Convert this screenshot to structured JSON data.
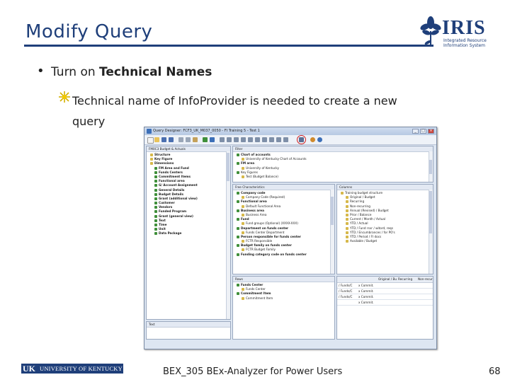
{
  "slide": {
    "title": "Modify Query",
    "bullet_prefix": "Turn on ",
    "bullet_bold": "Technical Names",
    "sub_bullet_line1": "Technical name of InfoProvider is needed to create a new",
    "sub_bullet_line2": "query",
    "footer_text": "BEX_305 BEx-Analyzer for Power Users",
    "page_number": "68"
  },
  "logo": {
    "brand": "IRIS",
    "tagline": "Integrated Resource Information System"
  },
  "footer_logo": {
    "uk": "UK",
    "university": "UNIVERSITY OF KENTUCKY"
  },
  "screenshot": {
    "window_title": "Query Designer: FCF3_UK_M037_0050 - FI Training 5 - Test 1",
    "left_pane": {
      "header": "FM0C3 Budget & Actuals",
      "items": [
        {
          "label": "Structure",
          "bold": true,
          "color": "#d6b84a"
        },
        {
          "label": "Key Figure",
          "bold": true,
          "color": "#d6b84a"
        },
        {
          "label": "Dimensions",
          "bold": true,
          "color": "#d6b84a"
        },
        {
          "label": "FM Area and Fund",
          "bold": true,
          "color": "#3f8f3a"
        },
        {
          "label": "Funds Centers",
          "bold": true,
          "color": "#3f8f3a"
        },
        {
          "label": "Commitment Items",
          "bold": true,
          "color": "#3f8f3a"
        },
        {
          "label": "Functional area",
          "bold": true,
          "color": "#3f8f3a"
        },
        {
          "label": "G/ Account Assignment",
          "bold": true,
          "color": "#3f8f3a"
        },
        {
          "label": "General Details",
          "bold": true,
          "color": "#3f8f3a"
        },
        {
          "label": "Budget Details",
          "bold": true,
          "color": "#3f8f3a"
        },
        {
          "label": "Grant (additional view)",
          "bold": true,
          "color": "#3f8f3a"
        },
        {
          "label": "Customer",
          "bold": true,
          "color": "#3f8f3a"
        },
        {
          "label": "Vendors",
          "bold": true,
          "color": "#3f8f3a"
        },
        {
          "label": "Funded Program",
          "bold": true,
          "color": "#3f8f3a"
        },
        {
          "label": "Grant (general view)",
          "bold": true,
          "color": "#3f8f3a"
        },
        {
          "label": "Text",
          "bold": true,
          "color": "#3f8f3a"
        },
        {
          "label": "Time",
          "bold": true,
          "color": "#3f8f3a"
        },
        {
          "label": "Unit",
          "bold": true,
          "color": "#3f8f3a"
        },
        {
          "label": "Data Package",
          "bold": true,
          "color": "#3f8f3a"
        }
      ]
    },
    "filter_pane": {
      "header": "Filter",
      "items": [
        {
          "label": "Chart of accounts",
          "bold": true,
          "color": "#3f8f3a"
        },
        {
          "label": "University of Kentucky Chart of Accounts",
          "bold": false,
          "color": "#d6b84a"
        },
        {
          "label": "FM area",
          "bold": true,
          "color": "#3f8f3a"
        },
        {
          "label": "University of Kentucky",
          "bold": false,
          "color": "#d6b84a"
        },
        {
          "label": "Key Figures",
          "bold": false,
          "color": "#3f8f3a"
        },
        {
          "label": "Test (Budget Balance)",
          "bold": false,
          "color": "#d6b84a"
        }
      ]
    },
    "free_char_pane": {
      "header": "Free Characteristics",
      "items": [
        {
          "label": "Company code",
          "bold": true,
          "color": "#3f8f3a"
        },
        {
          "label": "Company Code (Required)",
          "bold": false,
          "color": "#d6b84a"
        },
        {
          "label": "Functional area",
          "bold": true,
          "color": "#3f8f3a"
        },
        {
          "label": "Default Functional Area",
          "bold": false,
          "color": "#d6b84a"
        },
        {
          "label": "Business area",
          "bold": true,
          "color": "#3f8f3a"
        },
        {
          "label": "Business Area",
          "bold": false,
          "color": "#d6b84a"
        },
        {
          "label": "Fund",
          "bold": true,
          "color": "#3f8f3a"
        },
        {
          "label": "Fund groups (Optional) (XXXX-XXX)",
          "bold": false,
          "color": "#d6b84a"
        },
        {
          "label": "Department on funds center",
          "bold": true,
          "color": "#3f8f3a"
        },
        {
          "label": "Funds Center Department",
          "bold": false,
          "color": "#d6b84a"
        },
        {
          "label": "Person responsible for funds center",
          "bold": true,
          "color": "#3f8f3a"
        },
        {
          "label": "FCTR Responsible",
          "bold": false,
          "color": "#d6b84a"
        },
        {
          "label": "Budget family on funds center",
          "bold": true,
          "color": "#3f8f3a"
        },
        {
          "label": "FCTR Budget Family",
          "bold": false,
          "color": "#d6b84a"
        },
        {
          "label": "Funding category code on funds center",
          "bold": true,
          "color": "#3f8f3a"
        }
      ]
    },
    "columns_pane": {
      "header": "Columns",
      "items": [
        {
          "label": "Training budget structure",
          "bold": false,
          "color": "#d6b84a"
        },
        {
          "label": "Original / Budget",
          "bold": false,
          "color": "#d6b84a"
        },
        {
          "label": "Recurring",
          "bold": false,
          "color": "#d6b84a"
        },
        {
          "label": "Non-recurring",
          "bold": false,
          "color": "#d6b84a"
        },
        {
          "label": "Annual (Revised) / Budget",
          "bold": false,
          "color": "#d6b84a"
        },
        {
          "label": "Prior / Balance",
          "bold": false,
          "color": "#d6b84a"
        },
        {
          "label": "Current / Month / Actual",
          "bold": false,
          "color": "#d6b84a"
        },
        {
          "label": "YTD / Actual",
          "bold": false,
          "color": "#d6b84a"
        },
        {
          "label": "YTD / Fund rsvr / witord, reqs",
          "bold": false,
          "color": "#d6b84a"
        },
        {
          "label": "YTD / Encumbrances / for PO's",
          "bold": false,
          "color": "#d6b84a"
        },
        {
          "label": "YTD / Period / FI docs",
          "bold": false,
          "color": "#d6b84a"
        },
        {
          "label": "Available / Budget",
          "bold": false,
          "color": "#d6b84a"
        }
      ]
    },
    "rows_pane": {
      "header": "Rows",
      "items": [
        {
          "label": "Funds Center",
          "bold": true,
          "color": "#3f8f3a"
        },
        {
          "label": "Funds Center",
          "bold": false,
          "color": "#d6b84a"
        },
        {
          "label": "Commitment Item",
          "bold": true,
          "color": "#3f8f3a"
        },
        {
          "label": "Commitment Item",
          "bold": false,
          "color": "#d6b84a"
        }
      ]
    },
    "grid_pane": {
      "col_headers": [
        "Original / Bu",
        "Recurring",
        "Non-recur"
      ],
      "rows": [
        [
          "/ Funds/C",
          "x Commit.",
          ""
        ],
        [
          "/ Funds/C",
          "x Commit.",
          ""
        ],
        [
          "/ Funds/C",
          "x Commit.",
          ""
        ],
        [
          "",
          "x Commit.",
          ""
        ]
      ]
    },
    "properties_label": "Text"
  }
}
